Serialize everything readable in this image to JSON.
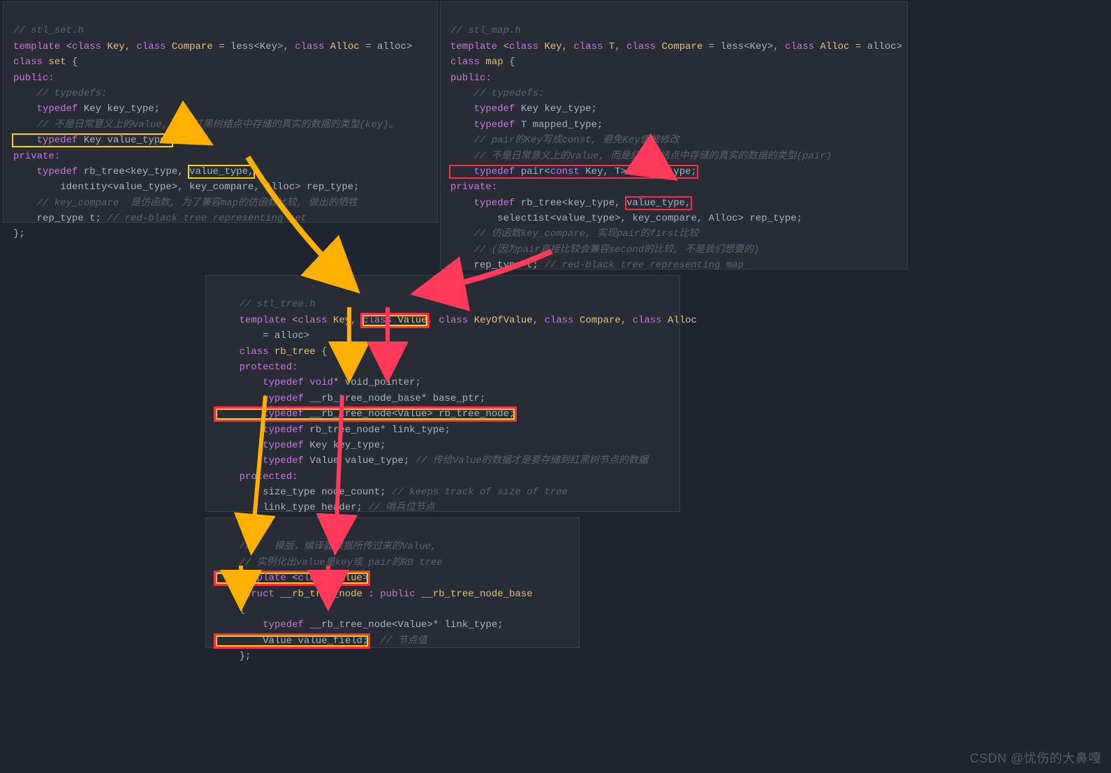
{
  "watermark": "CSDN @忧伤的大鼻嘎",
  "panels": {
    "set": {
      "file_comment": "// stl_set.h",
      "line2a": "template ",
      "line2b": "<",
      "line2c": "class ",
      "line2d": "Key",
      "line2e": ", ",
      "line2f": "class ",
      "line2g": "Compare",
      "line2h": " = less<Key>, ",
      "line2i": "class ",
      "line2j": "Alloc",
      "line2k": " = alloc>",
      "line3a": "class ",
      "line3b": "set ",
      "line3c": "{",
      "line4": "public:",
      "line5": "    // typedefs:",
      "line6a": "    typedef ",
      "line6b": "Key key_type;",
      "line7": "    // 不是日常意义上的value, 而是红黑树结点中存储的真实的数据的类型(key)。",
      "line8a": "    typedef ",
      "line8b": "Key value_type;",
      "line9": "private:",
      "line10a": "    typedef ",
      "line10b": "rb_tree<key_type, ",
      "line10c": "value_type,",
      "line11": "        identity<value_type>, key_compare, Alloc> rep_type;",
      "line12": "    // key_compare  是仿函数, 为了兼容map的仿函数比较, 做出的牺牲",
      "line13a": "    rep_type t; ",
      "line13b": "// red-black tree representing set",
      "line14": "};"
    },
    "map": {
      "file_comment": "// stl_map.h",
      "line2a": "template ",
      "line2b": "<",
      "line2c": "class ",
      "line2d": "Key",
      "line2e": ", ",
      "line2f": "class ",
      "line2g": "T",
      "line2h": ", ",
      "line2i": "class ",
      "line2j": "Compare",
      "line2k": " = less<Key>, ",
      "line2l": "class ",
      "line2m": "Alloc",
      "line2n": " = alloc>",
      "line3a": "class ",
      "line3b": "map ",
      "line3c": "{",
      "line4": "public:",
      "line5": "    // typedefs:",
      "line6a": "    typedef ",
      "line6b": "Key key_type;",
      "line7a": "    typedef ",
      "line7b": "T mapped_type;",
      "line8": "    // pair的Key写成const, 避免Key值被修改",
      "line9": "    // 不是日常意义上的value, 而是红黑树结点中存储的真实的数据的类型(pair)",
      "line10a": "    typedef ",
      "line10b": "pair<",
      "line10c": "const ",
      "line10d": "Key, T> value_type;",
      "line11": "private:",
      "line12a": "    typedef ",
      "line12b": "rb_tree<key_type, ",
      "line12c": "value_type,",
      "line13": "        select1st<value_type>, key_compare, Alloc> rep_type;",
      "line14": "    // 仿函数key_compare, 实现pair的first比较",
      "line15": "    // (因为pair直接比较会兼容second的比较, 不是我们想要的)",
      "line16a": "    rep_type t; ",
      "line16b": "// red-black tree representing map",
      "line17": "};"
    },
    "tree": {
      "file_comment": "    // stl_tree.h",
      "line2a": "    template ",
      "line2b": "<",
      "line2c": "class ",
      "line2d": "Key",
      "line2e": ", ",
      "line2f": "class ",
      "line2g": "Value",
      "line2h": ", ",
      "line2i": "class ",
      "line2j": "KeyOfValue",
      "line2k": ", ",
      "line2l": "class ",
      "line2m": "Compare",
      "line2n": ", ",
      "line2o": "class ",
      "line2p": "Alloc",
      "line3": "        = alloc>",
      "line4a": "    class ",
      "line4b": "rb_tree ",
      "line4c": "{",
      "line5": "    protected:",
      "line6a": "        typedef ",
      "line6b": "void",
      "line6c": "* void_pointer;",
      "line7a": "        typedef ",
      "line7b": "__rb_tree_node_base* base_ptr;",
      "line8a": "        typedef ",
      "line8b": "__rb_tree_node<Value> rb_tree_node;",
      "line9a": "        typedef ",
      "line9b": "rb_tree_node* link_type;",
      "line10a": "        typedef ",
      "line10b": "Key key_type;",
      "line11a": "        typedef ",
      "line11b": "Value value_type; ",
      "line11c": "// 传给Value的数据才是要存储到红黑树节点的数据",
      "line12": "    protected:",
      "line13a": "        size_type node_count; ",
      "line13b": "// keeps track of size of tree",
      "line14a": "        link_type header; ",
      "line14b": "// 哨兵位节点",
      "line15": "    };"
    },
    "node": {
      "line1": "    //    模版，编译器根据所传过来的Value,",
      "line2": "    // 实例化出value是key或 pair的RB tree",
      "line3a": "    template ",
      "line3b": "<",
      "line3c": "class ",
      "line3d": "Value",
      "line3e": ">",
      "line4a": "    struct ",
      "line4b": "__rb_tree_node",
      "line4c": " : ",
      "line4d": "public ",
      "line4e": "__rb_tree_node_base",
      "line5": "    {",
      "line6a": "        typedef ",
      "line6b": "__rb_tree_node<Value>* link_type;",
      "line7a": "        Value value_field;",
      "line7b": "  // 节点值",
      "line8": "    };"
    }
  }
}
